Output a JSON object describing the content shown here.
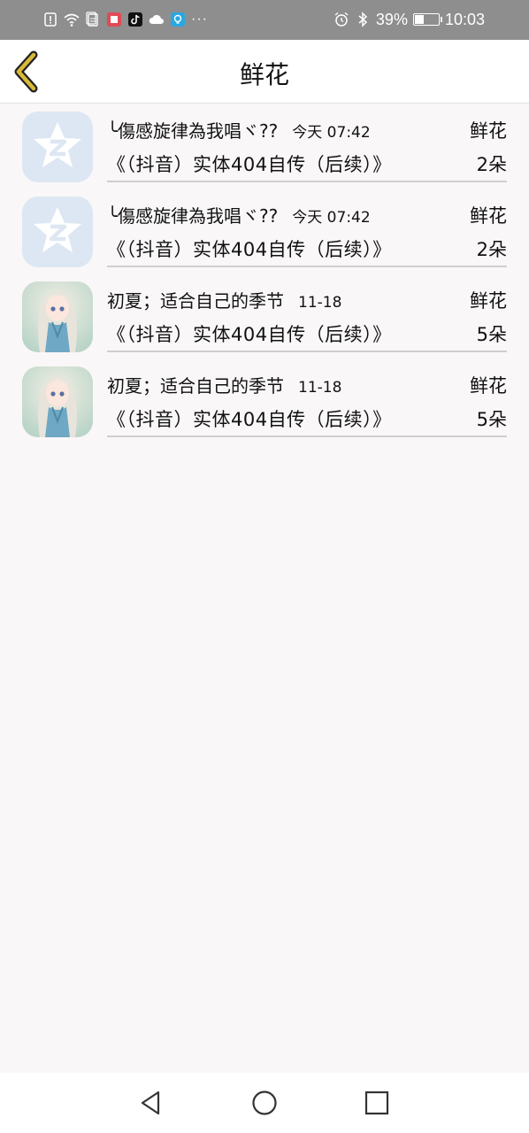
{
  "status_bar": {
    "battery": "39%",
    "battery_level": 0.39,
    "time": "10:03",
    "overflow": "···"
  },
  "header": {
    "title": "鲜花",
    "accent": "#d8b93a"
  },
  "records": [
    {
      "sender": "╰傷感旋律為我唱ヾ??",
      "time": "今天 07:42",
      "gift": "鲜花",
      "work": "《（抖音）实体404自传（后续）》",
      "count": "2朵",
      "avatar": "qq-default-avatar-icon"
    },
    {
      "sender": "╰傷感旋律為我唱ヾ??",
      "time": "今天 07:42",
      "gift": "鲜花",
      "work": "《（抖音）实体404自传（后续）》",
      "count": "2朵",
      "avatar": "qq-default-avatar-icon"
    },
    {
      "sender": "初夏；适合自己的季节",
      "time": "11-18",
      "gift": "鲜花",
      "work": "《（抖音）实体404自传（后续）》",
      "count": "5朵",
      "avatar": "anime-girl-avatar"
    },
    {
      "sender": "初夏；适合自己的季节",
      "time": "11-18",
      "gift": "鲜花",
      "work": "《（抖音）实体404自传（后续）》",
      "count": "5朵",
      "avatar": "anime-girl-avatar"
    }
  ]
}
